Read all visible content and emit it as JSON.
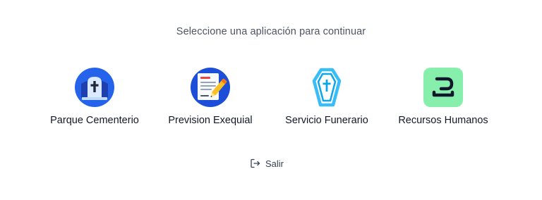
{
  "prompt": "Seleccione una aplicación para continuar",
  "apps": [
    {
      "label": "Parque Cementerio",
      "icon": "cemetery-tomb-icon",
      "color": "#2563eb"
    },
    {
      "label": "Prevision Exequial",
      "icon": "document-pen-icon",
      "color": "#1d4ed8"
    },
    {
      "label": "Servicio Funerario",
      "icon": "coffin-icon",
      "color": "#38bdf8"
    },
    {
      "label": "Recursos Humanos",
      "icon": "hr-logo-icon",
      "color": "#86efac"
    }
  ],
  "logout": {
    "label": "Salir",
    "icon": "logout-icon"
  }
}
